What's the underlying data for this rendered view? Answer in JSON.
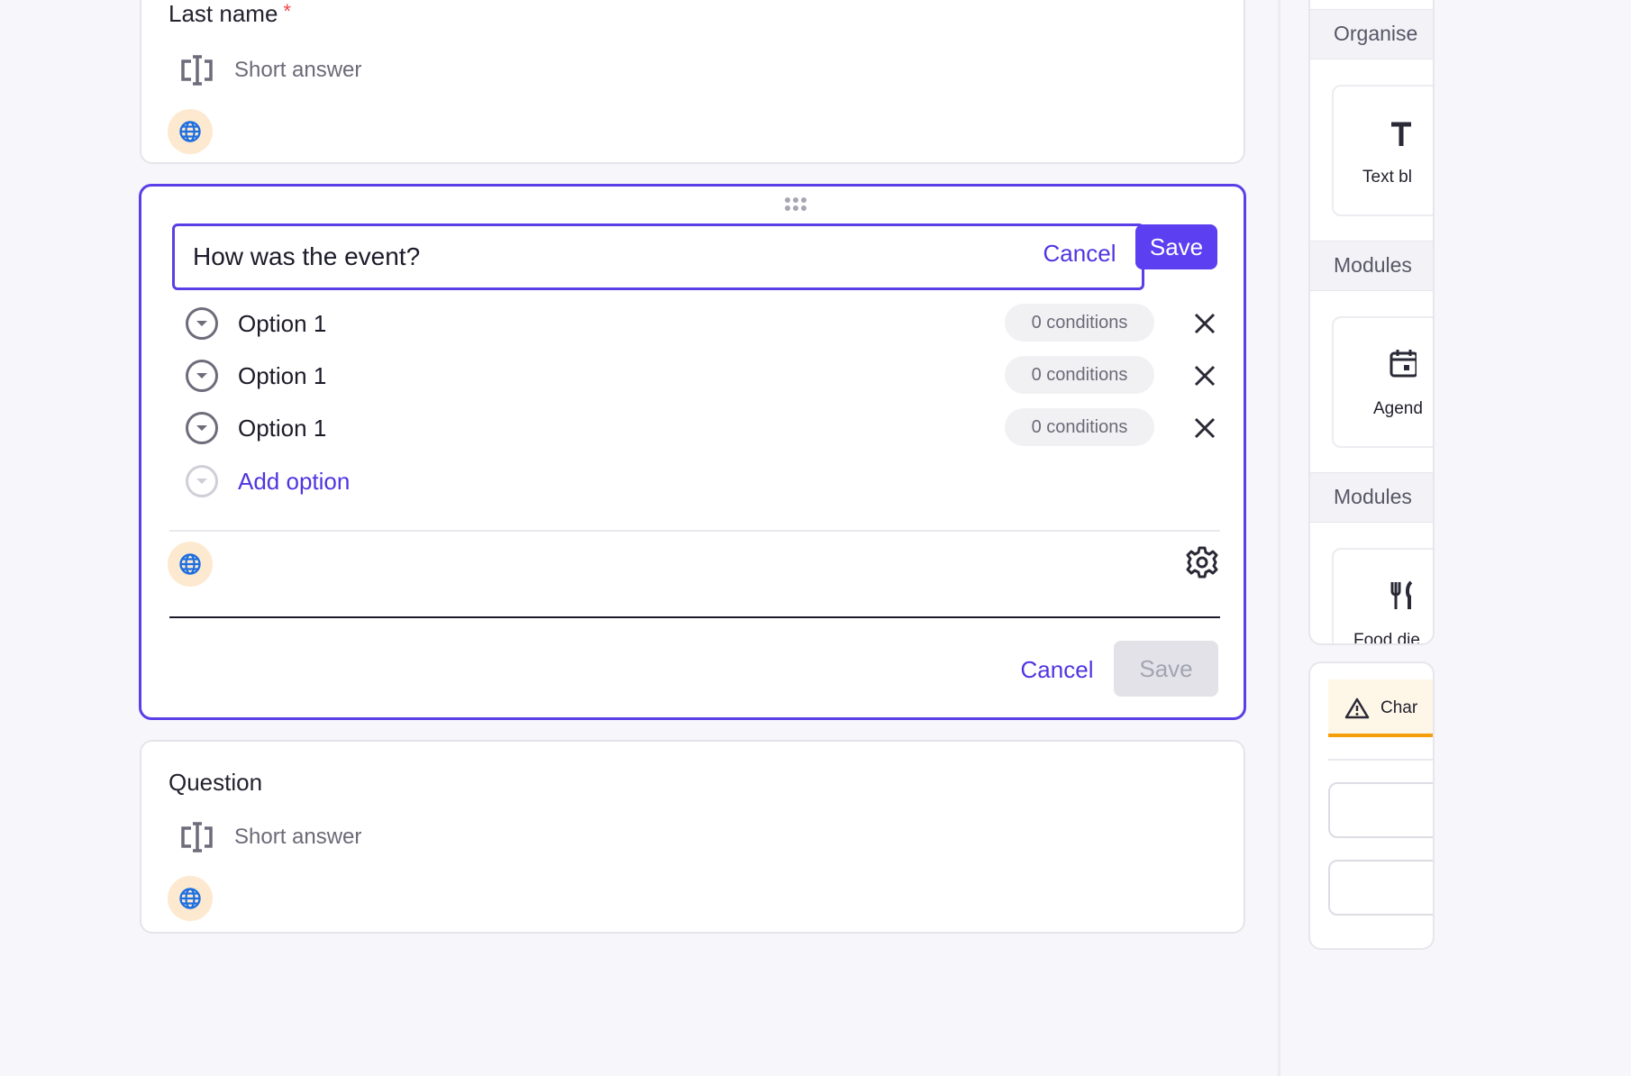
{
  "last_name_card": {
    "label": "Last name",
    "required_mark": "*",
    "answer_type": "Short answer"
  },
  "question_editor": {
    "question_value": "How was the event?",
    "top_cancel": "Cancel",
    "top_save": "Save",
    "options": [
      {
        "label": "Option 1",
        "conditions": "0 conditions"
      },
      {
        "label": "Option 1",
        "conditions": "0 conditions"
      },
      {
        "label": "Option 1",
        "conditions": "0 conditions"
      }
    ],
    "add_option": "Add option",
    "bottom_cancel": "Cancel",
    "bottom_save": "Save"
  },
  "question_card": {
    "label": "Question",
    "answer_type": "Short answer"
  },
  "sidebar": {
    "sections": [
      {
        "title": "Organise",
        "module": {
          "label": "Text bl",
          "icon": "text-block-icon"
        }
      },
      {
        "title": "Modules",
        "module": {
          "label": "Agend",
          "icon": "calendar-icon"
        }
      },
      {
        "title": "Modules",
        "module": {
          "label": "Food die",
          "icon": "fork-knife-icon"
        }
      }
    ],
    "warning_text": "Char"
  },
  "colors": {
    "accent": "#5b3ff0",
    "link": "#4f35e0",
    "globe_bg": "#fde9cf",
    "globe": "#1d6fe0",
    "warning": "#f59e0b"
  }
}
